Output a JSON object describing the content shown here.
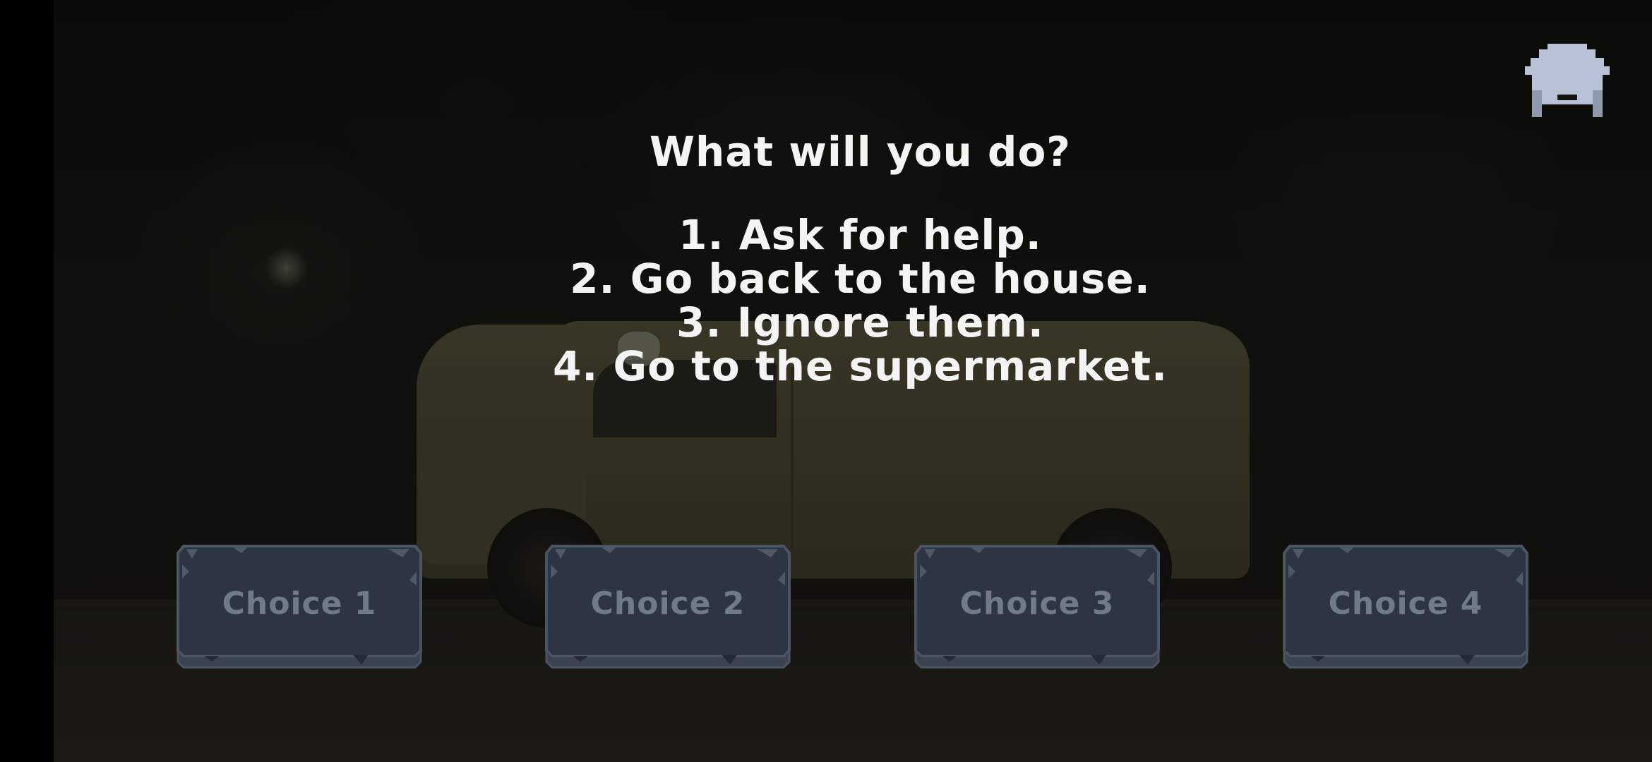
{
  "prompt": {
    "title": "What will you do?",
    "options": [
      "1. Ask for help.",
      "2. Go back to the house.",
      "3. Ignore them.",
      "4. Go to the supermarket."
    ]
  },
  "choices": [
    {
      "label": "Choice 1"
    },
    {
      "label": "Choice 2"
    },
    {
      "label": "Choice 3"
    },
    {
      "label": "Choice 4"
    }
  ],
  "icons": {
    "home": "home-icon"
  },
  "colors": {
    "prompt_text": "#f4f4f4",
    "button_fill": "#2e3542",
    "button_border": "#4b5463",
    "button_text": "#717b88",
    "home_icon": "#b9c1d6"
  }
}
